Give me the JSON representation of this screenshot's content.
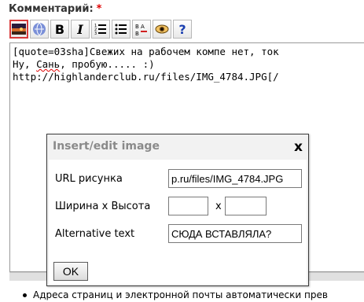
{
  "form": {
    "comment_label": "Комментарий:",
    "required_mark": "*"
  },
  "toolbar": {
    "buttons": [
      {
        "icon": "image-icon"
      },
      {
        "icon": "link-icon"
      },
      {
        "icon": "bold-icon",
        "text": "B"
      },
      {
        "icon": "italic-icon",
        "text": "I"
      },
      {
        "icon": "numbered-list-icon"
      },
      {
        "icon": "bullet-list-icon"
      },
      {
        "icon": "sort-icon"
      },
      {
        "icon": "preview-eye-icon"
      },
      {
        "icon": "help-icon",
        "text": "?"
      }
    ]
  },
  "editor": {
    "line1_a": "[quote=03sha]Свежих на рабочем компе нет, ток",
    "line2_a": "Ну, ",
    "line2_spell": "Сань",
    "line2_b": ", пробую..... :)",
    "line3": "http://highlanderclub.ru/files/IMG_4784.JPG[/"
  },
  "dialog": {
    "title": "Insert/edit image",
    "close": "x",
    "url_label": "URL рисунка",
    "url_value": "p.ru/files/IMG_4784.JPG",
    "size_label": "Ширина x Высота",
    "size_sep": "x",
    "width_value": "",
    "height_value": "",
    "alt_label": "Alternative text",
    "alt_value": "СЮДА ВСТАВЛЯЛА?",
    "ok_label": "OK"
  },
  "hint": {
    "text": "Адреса страниц и электронной почты автоматически прев"
  }
}
